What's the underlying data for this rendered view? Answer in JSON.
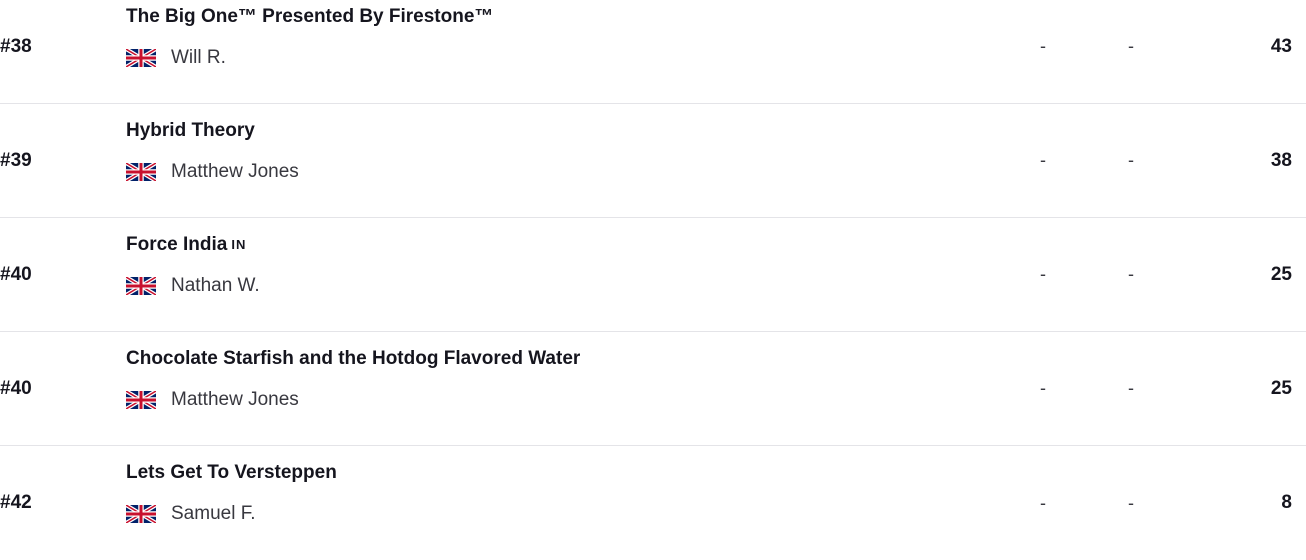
{
  "standings": {
    "rows": [
      {
        "rank": "#38",
        "team": "The Big One™ Presented By Firestone™",
        "team_suffix": "",
        "owner": "Will R.",
        "owner_flag": "uk-flag-icon",
        "col1": "-",
        "col2": "-",
        "points": "43"
      },
      {
        "rank": "#39",
        "team": "Hybrid Theory",
        "team_suffix": "",
        "owner": "Matthew Jones",
        "owner_flag": "uk-flag-icon",
        "col1": "-",
        "col2": "-",
        "points": "38"
      },
      {
        "rank": "#40",
        "team": "Force India",
        "team_suffix": "IN",
        "owner": "Nathan W.",
        "owner_flag": "uk-flag-icon",
        "col1": "-",
        "col2": "-",
        "points": "25"
      },
      {
        "rank": "#40",
        "team": "Chocolate Starfish and the Hotdog Flavored Water",
        "team_suffix": "",
        "owner": "Matthew Jones",
        "owner_flag": "uk-flag-icon",
        "col1": "-",
        "col2": "-",
        "points": "25"
      },
      {
        "rank": "#42",
        "team": "Lets Get To Versteppen",
        "team_suffix": "",
        "owner": "Samuel F.",
        "owner_flag": "uk-flag-icon",
        "col1": "-",
        "col2": "-",
        "points": "8"
      }
    ]
  },
  "colors": {
    "text_primary": "#15151e",
    "text_secondary": "#38383f",
    "divider": "#e4e4e8",
    "flag_blue": "#012169",
    "flag_red": "#c8102e"
  }
}
